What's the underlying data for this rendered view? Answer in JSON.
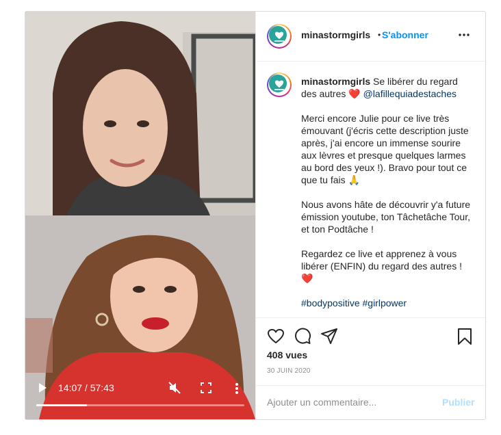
{
  "account": {
    "username": "minastormgirls",
    "separator": "•",
    "follow_label": "S'abonner"
  },
  "caption": {
    "username": "minastormgirls",
    "intro": "Se libérer du regard des autres",
    "heart": "❤️",
    "mention": "@lafillequiadestaches",
    "paragraph1": "Merci encore Julie pour ce live très émouvant (j'écris cette description juste après, j'ai encore un immense sourire aux lèvres et presque quelques larmes au bord des yeux !). Bravo pour tout ce que tu fais",
    "emoji_pray": "🙏",
    "paragraph2": "Nous avons hâte de découvrir y'a future émission youtube, ton Tâchetâche Tour, et ton Podtâche !",
    "paragraph3": "Regardez ce live et apprenez à vous libérer (ENFIN) du regard des autres !",
    "hashtags": "#bodypositive #girlpower"
  },
  "video": {
    "time_display": "14:07 / 57:43",
    "progress": 0.245
  },
  "actions": {
    "views": "408 vues",
    "date": "30 JUIN 2020"
  },
  "comment_box": {
    "placeholder": "Ajouter un commentaire...",
    "publish_label": "Publier"
  },
  "colors": {
    "accent": "#0095f6",
    "publish_disabled": "#b2dffc",
    "hashtag": "#00376b",
    "heart": "#ed4956"
  }
}
